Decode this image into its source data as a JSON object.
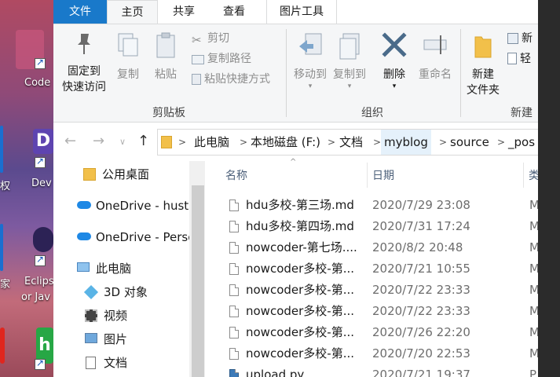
{
  "desktop": {
    "icons": [
      {
        "label": "Code"
      },
      {
        "label": "Dev"
      },
      {
        "label": "Eclips"
      },
      {
        "label": "or Jav"
      },
      {
        "label": "家"
      },
      {
        "label": "权"
      }
    ]
  },
  "ribbon": {
    "tabs": [
      "文件",
      "主页",
      "共享",
      "查看",
      "图片工具"
    ],
    "clipboard": {
      "pin_label_1": "固定到",
      "pin_label_2": "快速访问",
      "copy": "复制",
      "paste": "粘贴",
      "cut": "剪切",
      "copy_path": "复制路径",
      "paste_shortcut": "粘贴快捷方式",
      "group": "剪贴板"
    },
    "organize": {
      "move_to": "移动到",
      "copy_to": "复制到",
      "delete": "删除",
      "rename": "重命名",
      "group": "组织"
    },
    "new": {
      "new_folder_1": "新建",
      "new_folder_2": "文件夹",
      "new_item": "新",
      "easy_access": "轻",
      "group": "新建"
    }
  },
  "address": {
    "crumbs": [
      "此电脑",
      "本地磁盘 (F:)",
      "文档",
      "myblog",
      "source",
      "_pos"
    ]
  },
  "navpane": {
    "items": [
      {
        "label": "公用桌面",
        "icon": "folder-icon"
      },
      {
        "label": "OneDrive - hust.e",
        "icon": "cloud-icon"
      },
      {
        "label": "OneDrive - Perso",
        "icon": "cloud-icon"
      },
      {
        "label": "此电脑",
        "icon": "computer-icon"
      },
      {
        "label": "3D 对象",
        "icon": "cube-icon"
      },
      {
        "label": "视频",
        "icon": "video-icon"
      },
      {
        "label": "图片",
        "icon": "picture-icon"
      },
      {
        "label": "文档",
        "icon": "document-icon"
      }
    ]
  },
  "filelist": {
    "columns": {
      "name": "名称",
      "date": "日期",
      "type": "类"
    },
    "rows": [
      {
        "name": "hdu多校-第三场.md",
        "date": "2020/7/29 23:08",
        "type": "M"
      },
      {
        "name": "hdu多校-第四场.md",
        "date": "2020/7/31 17:24",
        "type": "M"
      },
      {
        "name": "nowcoder-第七场....",
        "date": "2020/8/2 20:48",
        "type": "M"
      },
      {
        "name": "nowcoder多校-第...",
        "date": "2020/7/21 10:55",
        "type": "M"
      },
      {
        "name": "nowcoder多校-第...",
        "date": "2020/7/22 23:33",
        "type": "M"
      },
      {
        "name": "nowcoder多校-第...",
        "date": "2020/7/22 23:33",
        "type": "M"
      },
      {
        "name": "nowcoder多校-第...",
        "date": "2020/7/26 22:20",
        "type": "M"
      },
      {
        "name": "nowcoder多校-第...",
        "date": "2020/7/20 22:53",
        "type": "M"
      },
      {
        "name": "upload.py",
        "date": "2020/7/21 19:37",
        "type": "P"
      }
    ]
  },
  "colors": {
    "accent": "#1979ca",
    "ribbon_bg": "#f5f6f7"
  }
}
